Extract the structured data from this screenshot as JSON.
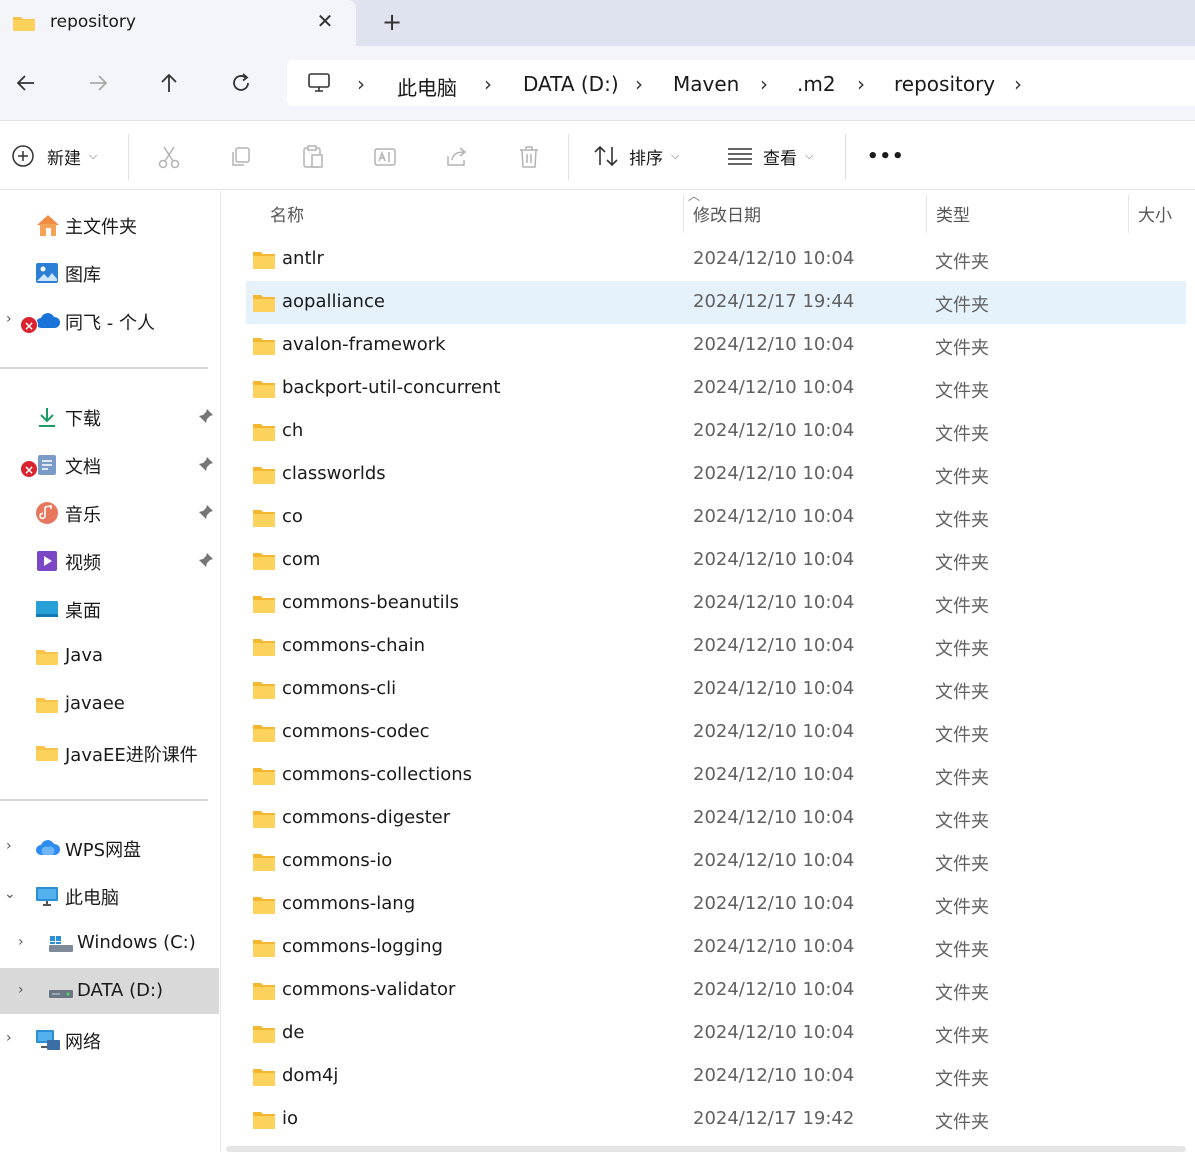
{
  "window": {
    "tab_title": "repository",
    "close_glyph": "✕",
    "new_tab_glyph": "+"
  },
  "nav": {
    "back_icon": "arrow-left",
    "forward_icon": "arrow-right",
    "up_icon": "arrow-up",
    "refresh_icon": "refresh"
  },
  "breadcrumb": {
    "items": [
      "此电脑",
      "DATA (D:)",
      "Maven",
      ".m2",
      "repository"
    ],
    "separator": "›"
  },
  "commands": {
    "new_label": "新建",
    "sort_label": "排序",
    "view_label": "查看",
    "more_label": "•••"
  },
  "sidebar": {
    "home": "主文件夹",
    "gallery": "图库",
    "onedrive": "同飞 - 个人",
    "downloads": "下载",
    "documents": "文档",
    "music": "音乐",
    "videos": "视频",
    "desktop": "桌面",
    "java": "Java",
    "javaee": "javaee",
    "javaee_course": "JavaEE进阶课件",
    "wps": "WPS网盘",
    "this_pc": "此电脑",
    "drive_c": "Windows (C:)",
    "drive_d": "DATA (D:)",
    "network": "网络",
    "error_glyph": "×"
  },
  "columns": {
    "name": "名称",
    "modified": "修改日期",
    "type": "类型",
    "size": "大小"
  },
  "files": [
    {
      "name": "antlr",
      "date": "2024/12/10 10:04",
      "type": "文件夹"
    },
    {
      "name": "aopalliance",
      "date": "2024/12/17 19:44",
      "type": "文件夹"
    },
    {
      "name": "avalon-framework",
      "date": "2024/12/10 10:04",
      "type": "文件夹"
    },
    {
      "name": "backport-util-concurrent",
      "date": "2024/12/10 10:04",
      "type": "文件夹"
    },
    {
      "name": "ch",
      "date": "2024/12/10 10:04",
      "type": "文件夹"
    },
    {
      "name": "classworlds",
      "date": "2024/12/10 10:04",
      "type": "文件夹"
    },
    {
      "name": "co",
      "date": "2024/12/10 10:04",
      "type": "文件夹"
    },
    {
      "name": "com",
      "date": "2024/12/10 10:04",
      "type": "文件夹"
    },
    {
      "name": "commons-beanutils",
      "date": "2024/12/10 10:04",
      "type": "文件夹"
    },
    {
      "name": "commons-chain",
      "date": "2024/12/10 10:04",
      "type": "文件夹"
    },
    {
      "name": "commons-cli",
      "date": "2024/12/10 10:04",
      "type": "文件夹"
    },
    {
      "name": "commons-codec",
      "date": "2024/12/10 10:04",
      "type": "文件夹"
    },
    {
      "name": "commons-collections",
      "date": "2024/12/10 10:04",
      "type": "文件夹"
    },
    {
      "name": "commons-digester",
      "date": "2024/12/10 10:04",
      "type": "文件夹"
    },
    {
      "name": "commons-io",
      "date": "2024/12/10 10:04",
      "type": "文件夹"
    },
    {
      "name": "commons-lang",
      "date": "2024/12/10 10:04",
      "type": "文件夹"
    },
    {
      "name": "commons-logging",
      "date": "2024/12/10 10:04",
      "type": "文件夹"
    },
    {
      "name": "commons-validator",
      "date": "2024/12/10 10:04",
      "type": "文件夹"
    },
    {
      "name": "de",
      "date": "2024/12/10 10:04",
      "type": "文件夹"
    },
    {
      "name": "dom4j",
      "date": "2024/12/10 10:04",
      "type": "文件夹"
    },
    {
      "name": "io",
      "date": "2024/12/17 19:42",
      "type": "文件夹"
    }
  ],
  "state": {
    "hovered_row": "aopalliance",
    "selected_sidebar": "DATA (D:)"
  },
  "colors": {
    "accent": "#0067c0",
    "folder": "#f8c34a",
    "hover_row": "#e5f1fb",
    "selected_nav": "#d9d9d9"
  }
}
